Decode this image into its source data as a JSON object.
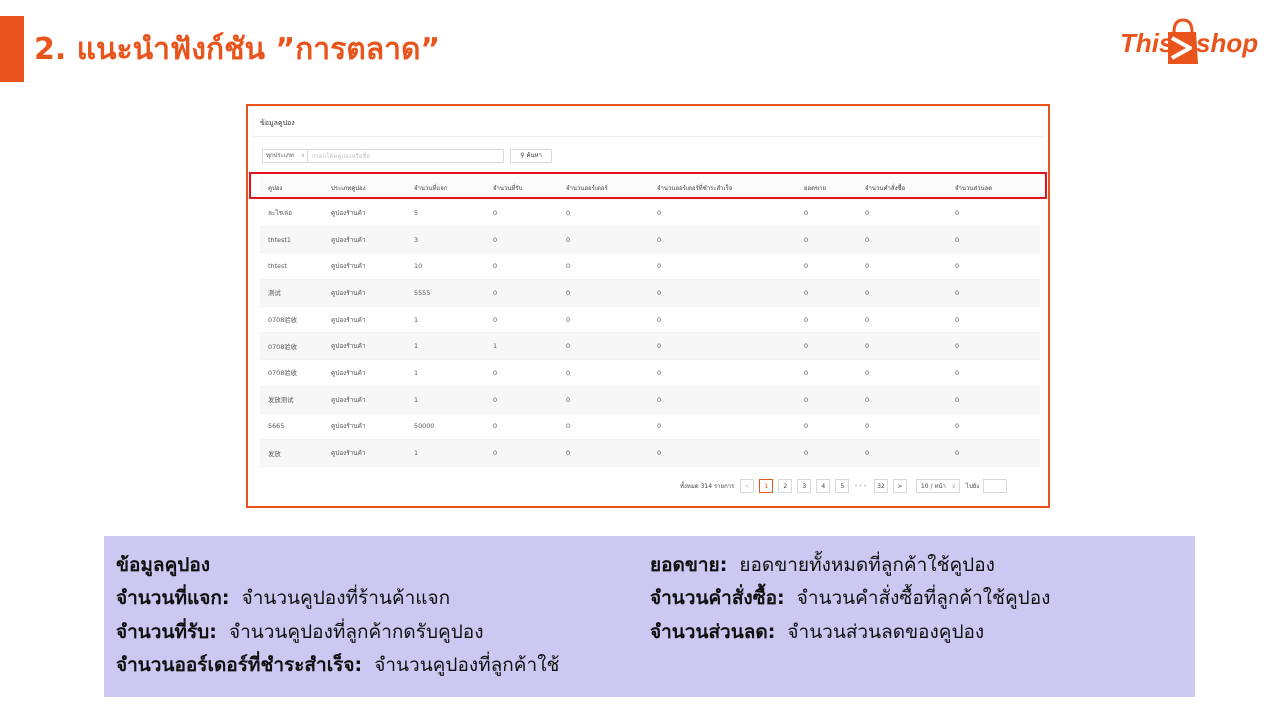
{
  "slide": {
    "title": "2. แนะนำฟังก์ชัน ”การตลาด”",
    "accent_color": "#e8541c",
    "logo": {
      "part1": "This",
      "part2": "shop",
      "icon": "shopping-bag-icon"
    }
  },
  "panel": {
    "title": "ข้อมูลคูปอง",
    "filter_select": "ทุกประเภท",
    "search_placeholder": "กรอกโค้ดคูปองหรือชื่อ",
    "search_button": "ค้นหา",
    "columns": [
      "คูปอง",
      "ประเภทคูปอง",
      "จำนวนที่แจก",
      "จำนวนที่รับ",
      "จำนวนออร์เดอร์",
      "จำนวนออร์เดอร์ที่ชำระสำเร็จ",
      "ยอดขาย",
      "จำนวนคำสั่งซื้อ",
      "จำนวนส่วนลด"
    ],
    "rows": [
      [
        "ละไรเล่อ",
        "คูปองร้านค้า",
        "5",
        "0",
        "0",
        "0",
        "0",
        "0",
        "0"
      ],
      [
        "thtest1",
        "คูปองร้านค้า",
        "3",
        "0",
        "0",
        "0",
        "0",
        "0",
        "0"
      ],
      [
        "thtest",
        "คูปองร้านค้า",
        "10",
        "0",
        "0",
        "0",
        "0",
        "0",
        "0"
      ],
      [
        "测试",
        "คูปองร้านค้า",
        "5555",
        "0",
        "0",
        "0",
        "0",
        "0",
        "0"
      ],
      [
        "0708验收",
        "คูปองร้านค้า",
        "1",
        "0",
        "0",
        "0",
        "0",
        "0",
        "0"
      ],
      [
        "0708验收",
        "คูปองร้านค้า",
        "1",
        "1",
        "0",
        "0",
        "0",
        "0",
        "0"
      ],
      [
        "0708验收",
        "คูปองร้านค้า",
        "1",
        "0",
        "0",
        "0",
        "0",
        "0",
        "0"
      ],
      [
        "发放测试",
        "คูปองร้านค้า",
        "1",
        "0",
        "0",
        "0",
        "0",
        "0",
        "0"
      ],
      [
        "5665",
        "คูปองร้านค้า",
        "50000",
        "0",
        "0",
        "0",
        "0",
        "0",
        "0"
      ],
      [
        "发放",
        "คูปองร้านค้า",
        "1",
        "0",
        "0",
        "0",
        "0",
        "0",
        "0"
      ]
    ],
    "pagination": {
      "total": "ทั้งหมด 314 รายการ",
      "prev": "<",
      "pages": [
        "1",
        "2",
        "3",
        "4",
        "5"
      ],
      "active": "1",
      "ellipsis": "•••",
      "last": "32",
      "next": ">",
      "page_size": "10 / หน้า",
      "goto_label": "ไปยัง"
    }
  },
  "legend": {
    "heading": "ข้อมูลคูปอง",
    "left": [
      {
        "term": "จำนวนที่แจก",
        "desc": "จำนวนคูปองที่ร้านค้าแจก"
      },
      {
        "term": "จำนวนที่รับ",
        "desc": "จำนวนคูปองที่ลูกค้ากดรับคูปอง"
      },
      {
        "term": "จำนวนออร์เดอร์ที่ชำระสำเร็จ",
        "desc": "จำนวนคูปองที่ลูกค้าใช้"
      }
    ],
    "right": [
      {
        "term": "ยอดขาย",
        "desc": "ยอดขายทั้งหมดที่ลูกค้าใช้คูปอง"
      },
      {
        "term": "จำนวนคำสั่งซื้อ",
        "desc": "จำนวนคำสั่งซื้อที่ลูกค้าใช้คูปอง"
      },
      {
        "term": "จำนวนส่วนลด",
        "desc": "จำนวนส่วนลดของคูปอง"
      }
    ]
  }
}
